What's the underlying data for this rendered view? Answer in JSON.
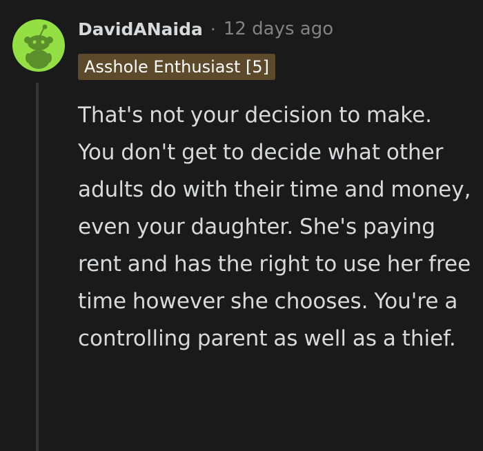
{
  "comment": {
    "author": "DavidANaida",
    "separator": "·",
    "timestamp": "12 days ago",
    "flair": "Asshole Enthusiast [5]",
    "body": "That's not your decision to make. You don't get to decide what other adults do with their time and money, even your daughter. She's paying rent and has the right to use her free time however she chooses. You're a controlling parent as well as a thief.",
    "avatar_icon": "snoo-avatar-icon"
  },
  "colors": {
    "background": "#1a1a1b",
    "avatar_bg": "#94e044",
    "flair_bg": "#5c4a2b",
    "text_primary": "#d7dadc",
    "text_muted": "#818384",
    "thread_line": "#343536"
  }
}
